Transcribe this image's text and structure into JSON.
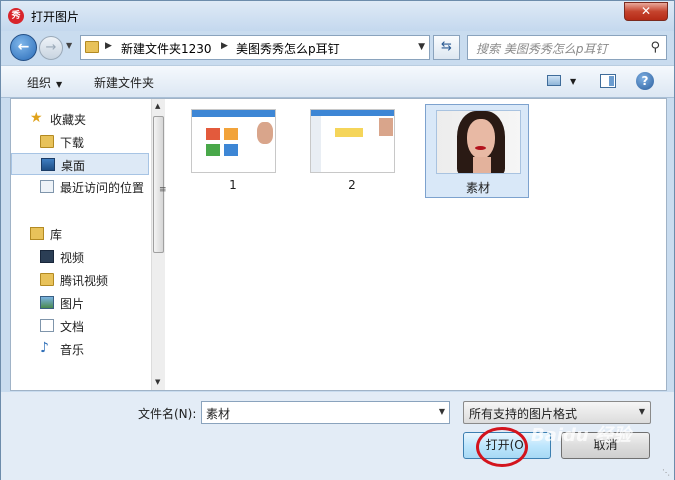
{
  "window": {
    "title": "打开图片",
    "app_icon": "秀",
    "close_label": "✕"
  },
  "navigation": {
    "address_segments": [
      "新建文件夹1230",
      "美图秀秀怎么p耳钉"
    ],
    "search_placeholder": "搜索 美图秀秀怎么p耳钉"
  },
  "toolbar": {
    "organize_label": "组织",
    "new_folder_label": "新建文件夹"
  },
  "sidebar": {
    "favorites_label": "收藏夹",
    "favorites": [
      {
        "label": "下载",
        "icon": "download-folder-icon"
      },
      {
        "label": "桌面",
        "icon": "desktop-icon"
      },
      {
        "label": "最近访问的位置",
        "icon": "recent-places-icon"
      }
    ],
    "libraries_label": "库",
    "libraries": [
      {
        "label": "视频",
        "icon": "video-icon"
      },
      {
        "label": "腾讯视频",
        "icon": "folder-icon"
      },
      {
        "label": "图片",
        "icon": "pictures-icon"
      },
      {
        "label": "文档",
        "icon": "documents-icon"
      },
      {
        "label": "音乐",
        "icon": "music-icon"
      }
    ],
    "selected": "桌面"
  },
  "files": [
    {
      "name": "1"
    },
    {
      "name": "2"
    },
    {
      "name": "素材"
    }
  ],
  "footer": {
    "filename_label": "文件名(N):",
    "filename_value": "素材",
    "filter_value": "所有支持的图片格式",
    "open_label": "打开(O)",
    "cancel_label": "取消"
  },
  "watermark": "Baidu 经验",
  "colors": {
    "selection": "#d9e8f8",
    "annotation_circle": "#d3141d",
    "accent": "#3d86d5"
  }
}
